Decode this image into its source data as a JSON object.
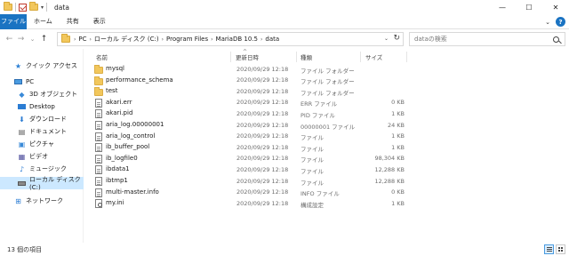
{
  "window": {
    "title": "data",
    "minimize": "—",
    "maximize": "☐",
    "close": "✕"
  },
  "ribbon": {
    "tabs": [
      "ファイル",
      "ホーム",
      "共有",
      "表示"
    ]
  },
  "nav": {
    "back": "←",
    "forward": "→",
    "recent": "⌄",
    "up": "↑",
    "breadcrumb": [
      "PC",
      "ローカル ディスク (C:)",
      "Program Files",
      "MariaDB 10.5",
      "data"
    ],
    "search_placeholder": "dataの検索"
  },
  "sidebar": {
    "items": [
      {
        "label": "クイック アクセス",
        "icon": "star-icon"
      },
      {
        "label": "PC",
        "icon": "pc-icon"
      },
      {
        "label": "3D オブジェクト",
        "icon": "cube-icon"
      },
      {
        "label": "Desktop",
        "icon": "desktop-icon"
      },
      {
        "label": "ダウンロード",
        "icon": "download-icon"
      },
      {
        "label": "ドキュメント",
        "icon": "documents-icon"
      },
      {
        "label": "ピクチャ",
        "icon": "pictures-icon"
      },
      {
        "label": "ビデオ",
        "icon": "video-icon"
      },
      {
        "label": "ミュージック",
        "icon": "music-icon"
      },
      {
        "label": "ローカル ディスク (C:)",
        "icon": "drive-icon",
        "selected": true
      },
      {
        "label": "ネットワーク",
        "icon": "network-icon"
      }
    ]
  },
  "columns": {
    "name": "名前",
    "date": "更新日時",
    "type": "種類",
    "size": "サイズ"
  },
  "files": [
    {
      "name": "mysql",
      "date": "2020/09/29 12:18",
      "type": "ファイル フォルダー",
      "size": "",
      "kind": "folder"
    },
    {
      "name": "performance_schema",
      "date": "2020/09/29 12:18",
      "type": "ファイル フォルダー",
      "size": "",
      "kind": "folder"
    },
    {
      "name": "test",
      "date": "2020/09/29 12:18",
      "type": "ファイル フォルダー",
      "size": "",
      "kind": "folder"
    },
    {
      "name": "akari.err",
      "date": "2020/09/29 12:18",
      "type": "ERR ファイル",
      "size": "0 KB",
      "kind": "file"
    },
    {
      "name": "akari.pid",
      "date": "2020/09/29 12:18",
      "type": "PID ファイル",
      "size": "1 KB",
      "kind": "file"
    },
    {
      "name": "aria_log.00000001",
      "date": "2020/09/29 12:18",
      "type": "00000001 ファイル",
      "size": "24 KB",
      "kind": "file"
    },
    {
      "name": "aria_log_control",
      "date": "2020/09/29 12:18",
      "type": "ファイル",
      "size": "1 KB",
      "kind": "file"
    },
    {
      "name": "ib_buffer_pool",
      "date": "2020/09/29 12:18",
      "type": "ファイル",
      "size": "1 KB",
      "kind": "file"
    },
    {
      "name": "ib_logfile0",
      "date": "2020/09/29 12:18",
      "type": "ファイル",
      "size": "98,304 KB",
      "kind": "file"
    },
    {
      "name": "ibdata1",
      "date": "2020/09/29 12:18",
      "type": "ファイル",
      "size": "12,288 KB",
      "kind": "file"
    },
    {
      "name": "ibtmp1",
      "date": "2020/09/29 12:18",
      "type": "ファイル",
      "size": "12,288 KB",
      "kind": "file"
    },
    {
      "name": "multi-master.info",
      "date": "2020/09/29 12:18",
      "type": "INFO ファイル",
      "size": "0 KB",
      "kind": "file"
    },
    {
      "name": "my.ini",
      "date": "2020/09/29 12:18",
      "type": "構成設定",
      "size": "1 KB",
      "kind": "ini"
    }
  ],
  "status": {
    "count": "13 個の項目"
  },
  "colors": {
    "accent": "#1a73c2",
    "selection": "#cce8ff",
    "folder": "#f2c75c"
  }
}
